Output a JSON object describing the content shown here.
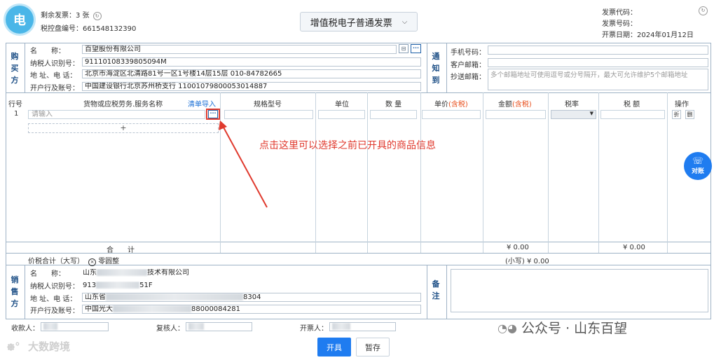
{
  "header": {
    "logo_text": "电",
    "remaining_label": "剩余发票：",
    "remaining_value": "3 张",
    "tax_disk_label": "税控盘编号：",
    "tax_disk_value": "661548132390",
    "invoice_type": "增值税电子普通发票",
    "code_label": "发票代码：",
    "number_label": "发票号码：",
    "date_label": "开票日期：",
    "date_value": "2024年01月12日"
  },
  "buyer": {
    "section": [
      "购",
      "买",
      "方"
    ],
    "name_label": "名　　称：",
    "name_value": "百望股份有限公司",
    "tax_id_label": "纳税人识别号：",
    "tax_id_value": "91110108339805094M",
    "address_label": "地 址、电 话：",
    "address_value": "北京市海淀区北清路81号一区1号楼14层15层 010-84782665",
    "bank_label": "开户行及账号：",
    "bank_value": "中国建设银行北京苏州桥支行 11001079800053014887"
  },
  "notify": {
    "section": [
      "通",
      "知",
      "到"
    ],
    "phone_label": "手机号码：",
    "email_label": "客户邮箱：",
    "cc_label": "抄送邮箱：",
    "cc_placeholder": "多个邮箱地址可使用逗号或分号隔开，最大可允许维护5个邮箱地址"
  },
  "table": {
    "headers": {
      "row": "行号",
      "goods": "货物或应税劳务.服务名称",
      "import": "清单导入",
      "spec": "规格型号",
      "unit": "单位",
      "qty": "数 量",
      "price": "单价",
      "amount": "金额",
      "tax_included": "(含税)",
      "rate": "税率",
      "tax": "税 额",
      "ops": "操作"
    },
    "row1_num": "1",
    "row1_placeholder": "请输入",
    "more_btn": "···",
    "add_btn": "+",
    "op_fold": "折",
    "op_delete": "删",
    "total_label": "合　　计",
    "total_amount": "¥ 0.00",
    "total_tax": "¥ 0.00",
    "grand_label": "价税合计（大写）",
    "grand_upper": "零圆整",
    "grand_lower": "(小写) ¥ 0.00"
  },
  "annotation": "点击这里可以选择之前已开具的商品信息",
  "seller": {
    "section": [
      "销",
      "售",
      "方"
    ],
    "name_label": "名　　称：",
    "name_prefix": "山东",
    "name_suffix": "技术有限公司",
    "tax_id_label": "纳税人识别号：",
    "tax_id_prefix": "913",
    "tax_id_suffix": "51F",
    "address_label": "地 址、电 话：",
    "address_prefix": "山东省",
    "address_suffix": "8304",
    "bank_label": "开户行及账号：",
    "bank_prefix": "中国光大",
    "bank_suffix": "88000084281"
  },
  "remark": {
    "section": [
      "备",
      "注"
    ]
  },
  "footer": {
    "payee_label": "收款人：",
    "checker_label": "复核人：",
    "drawer_label": "开票人：",
    "issue_btn": "开具",
    "save_btn": "暂存",
    "watermark_left": "大数跨境",
    "watermark_right": "公众号 · 山东百望"
  },
  "side_widget": "对账"
}
